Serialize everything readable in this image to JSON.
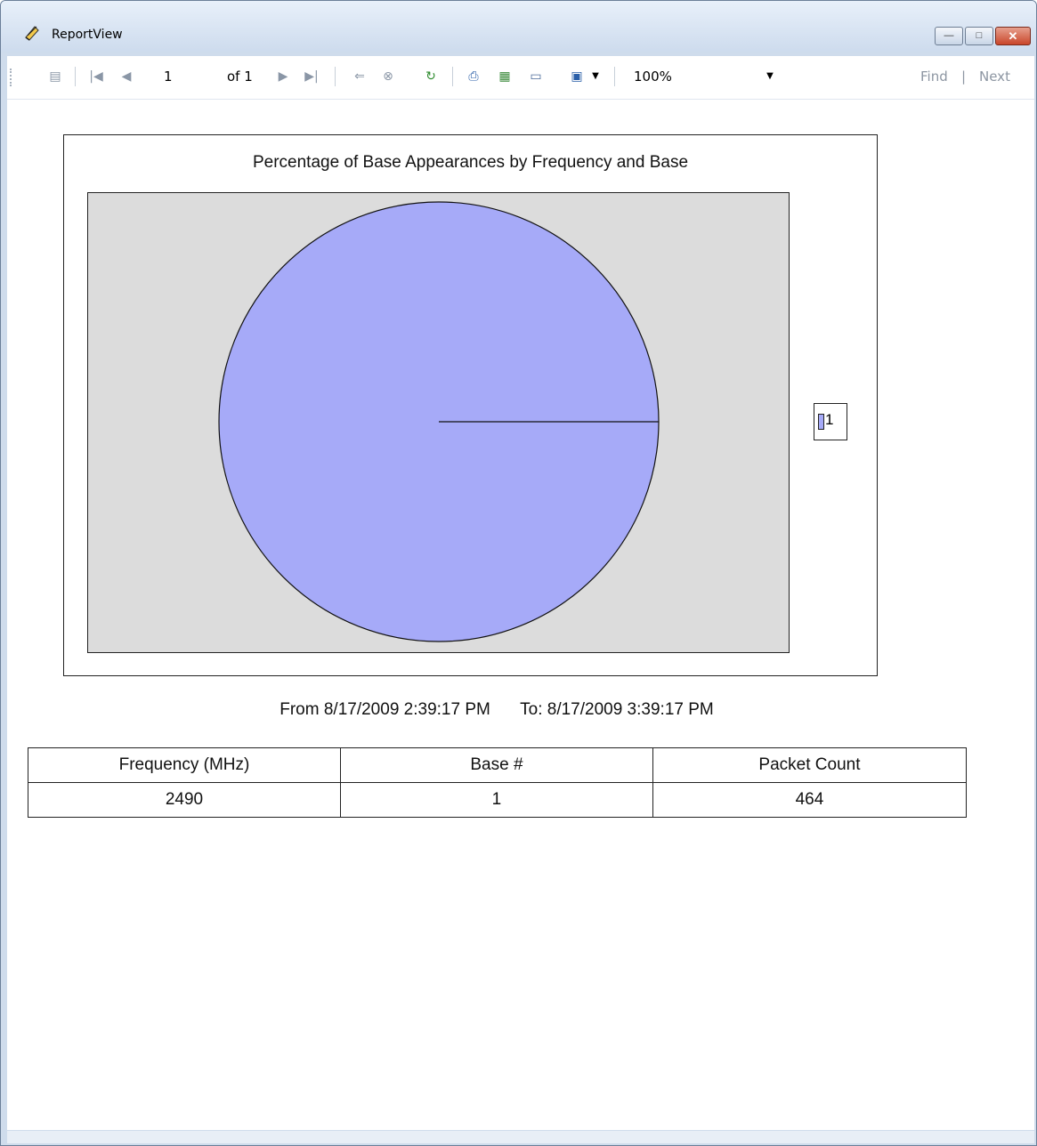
{
  "window": {
    "title": "ReportView",
    "buttons": {
      "minimize": "—",
      "maximize": "□",
      "close": "✕"
    }
  },
  "toolbar": {
    "page_current": "1",
    "page_of": "of 1",
    "zoom": "100%",
    "find_label": "Find",
    "next_label": "Next",
    "icons": [
      "document-map-icon",
      "first-page-icon",
      "prev-page-icon",
      "next-page-icon",
      "last-page-icon",
      "back-icon",
      "stop-icon",
      "refresh-icon",
      "print-icon",
      "print-layout-icon",
      "page-setup-icon",
      "save-icon",
      "zoom-dropdown-icon"
    ]
  },
  "report": {
    "range_from": "From 8/17/2009 2:39:17 PM",
    "range_to": "To: 8/17/2009 3:39:17 PM",
    "table": {
      "headers": [
        "Frequency (MHz)",
        "Base #",
        "Packet Count"
      ],
      "rows": [
        [
          "2490",
          "1",
          "464"
        ]
      ]
    }
  },
  "chart_data": {
    "type": "pie",
    "title": "Percentage of Base Appearances by Frequency and Base",
    "categories": [
      "1"
    ],
    "values": [
      100
    ],
    "colors": [
      "#a6aaf8"
    ],
    "plot_background": "#dcdcdc",
    "legend": "right",
    "legend_entries": [
      "1"
    ]
  }
}
